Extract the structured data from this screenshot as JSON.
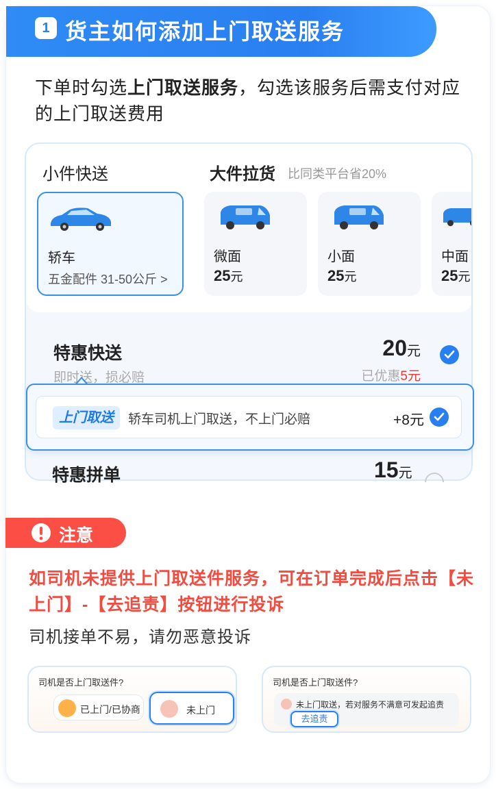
{
  "header": {
    "step_number": "1",
    "title": "货主如何添加上门取送服务"
  },
  "intro": {
    "part1": "下单时勾选",
    "highlight": "上门取送服务",
    "part2": "，勾选该服务后需支付对应的上门取送费用"
  },
  "service_panel": {
    "tab_small": "小件快送",
    "tab_big": "大件拉货",
    "tab_big_note": "比同类平台省20%",
    "vehicles": [
      {
        "name": "轿车",
        "desc": "五金配件 31-50公斤",
        "chevron": ">",
        "selected": true
      },
      {
        "name": "微面",
        "price": "25",
        "unit": "元"
      },
      {
        "name": "小面",
        "price": "25",
        "unit": "元"
      },
      {
        "name": "中面",
        "price": "25",
        "unit": "元"
      }
    ],
    "offer": {
      "title": "特惠快送",
      "subtitle": "即时送，损必赔",
      "price": "20",
      "unit": "元",
      "saving_prefix": "已优惠",
      "saving_amount": "5元"
    },
    "pickup": {
      "badge": "上门取送",
      "text": "轿车司机上门取送，不上门必赔",
      "price": "+8元"
    },
    "offer2": {
      "title": "特惠拼单",
      "price": "15",
      "unit": "元"
    }
  },
  "notice": {
    "label": "注意",
    "warning": "如司机未提供上门取送件服务，可在订单完成后点击【未上门】-【去追责】按钮进行投诉",
    "sub": "司机接单不易，请勿恶意投诉"
  },
  "mini_left": {
    "question": "司机是否上门取送件?",
    "option1": "已上门/已协商",
    "option2": "未上门"
  },
  "mini_right": {
    "question": "司机是否上门取送件?",
    "info": "未上门取送，若对服务不满意可发起追责",
    "button": "去追责"
  },
  "colors": {
    "primary_blue": "#2a7ff0",
    "warning_red": "#f24b3f",
    "saving_red": "#e53935"
  }
}
